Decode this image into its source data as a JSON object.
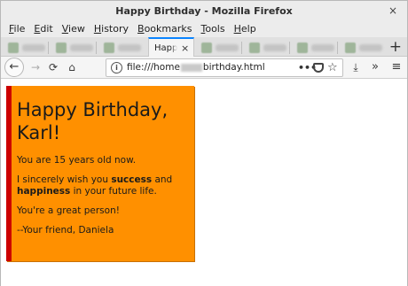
{
  "window": {
    "title": "Happy Birthday - Mozilla Firefox",
    "close_glyph": "×"
  },
  "menu": [
    {
      "key": "F",
      "rest": "ile"
    },
    {
      "key": "E",
      "rest": "dit"
    },
    {
      "key": "V",
      "rest": "iew"
    },
    {
      "key": "H",
      "rest": "istory"
    },
    {
      "key": "B",
      "rest": "ookmarks"
    },
    {
      "key": "T",
      "rest": "ools"
    },
    {
      "key": "H",
      "rest": "elp"
    }
  ],
  "tabs": {
    "active_label": "Happy",
    "active_close": "×",
    "new_tab": "+"
  },
  "nav": {
    "back": "←",
    "forward": "→",
    "reload": "⟳",
    "home": "⌂",
    "url_prefix": "file:///home",
    "url_suffix": "birthday.html",
    "page_actions": "•••",
    "star": "☆",
    "download": "⤓",
    "overflow": "»",
    "menu": "≡"
  },
  "page": {
    "heading": "Happy Birthday, Karl!",
    "age_line": "You are 15 years old now.",
    "wish_pre": "I sincerely wish you ",
    "wish_success": "success",
    "wish_mid": " and ",
    "wish_happiness": "happiness",
    "wish_post": " in your future life.",
    "great": "You're a great person!",
    "signature": "--Your friend, Daniela"
  },
  "colors": {
    "card_bg": "#ff9000",
    "card_border": "#cc0000",
    "tab_accent": "#0a84ff"
  }
}
